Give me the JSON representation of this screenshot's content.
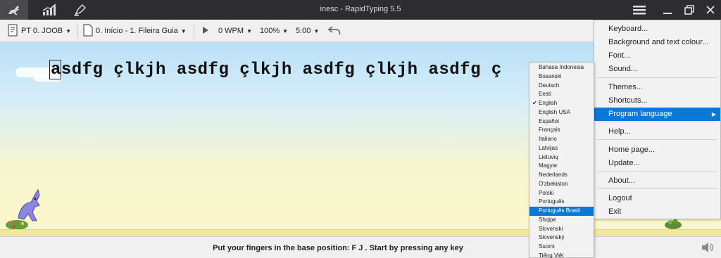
{
  "window": {
    "title": "inesc - RapidTyping 5.5"
  },
  "titlebar": {
    "icons": [
      "kangaroo-icon",
      "statistics-icon",
      "editor-icon"
    ],
    "controls": [
      "hamburger-menu-icon",
      "minimize-icon",
      "restore-icon",
      "close-icon"
    ]
  },
  "toolbar": {
    "keyboard_layout": "PT 0. JOOB",
    "lesson": "0. Início - 1. Fileira Guia",
    "speed": "0 WPM",
    "zoom": "100%",
    "timer": "5:00"
  },
  "main": {
    "typing_text": "asdfg çlkjh asdfg çlkjh asdfg çlkjh asdfg ç"
  },
  "status": {
    "message": "Put your fingers in the base position:  F  J .  Start by pressing any key"
  },
  "settings_menu": {
    "items": [
      {
        "label": "Keyboard..."
      },
      {
        "label": "Background and text colour..."
      },
      {
        "label": "Font..."
      },
      {
        "label": "Sound..."
      },
      {
        "label": "Themes..."
      },
      {
        "label": "Shortcuts..."
      },
      {
        "label": "Program language",
        "highlighted": true,
        "has_submenu": true
      },
      {
        "label": "Help..."
      },
      {
        "label": "Home page..."
      },
      {
        "label": "Update..."
      },
      {
        "label": "About..."
      },
      {
        "label": "Logout"
      },
      {
        "label": "Exit"
      }
    ]
  },
  "language_menu": {
    "items": [
      "Bahasa Indonesia",
      "Bosanski",
      "Deutsch",
      "Eesti",
      "English",
      "English USA",
      "Español",
      "Français",
      "Italiano",
      "Latvijas",
      "Lietuvių",
      "Magyar",
      "Nederlands",
      "O'zbekiston",
      "Polski",
      "Português",
      "Português Brasil",
      "Shqipe",
      "Slovenski",
      "Slovenský",
      "Suomi",
      "Tiếng Việt"
    ],
    "checked": "English",
    "highlighted": "Português Brasil"
  },
  "colors": {
    "accent": "#0a78d7",
    "titlebar": "#2d2d30"
  }
}
